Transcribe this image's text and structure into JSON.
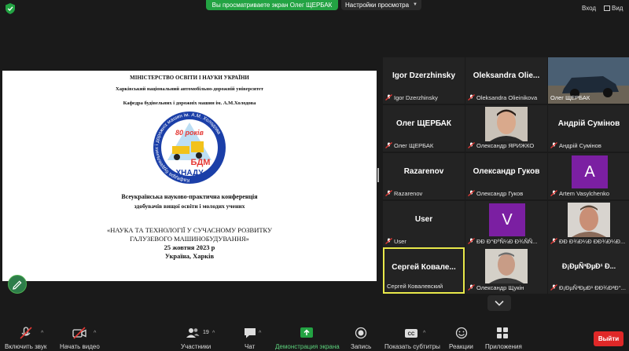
{
  "topbar": {
    "share_banner": "Вы просматриваете экран Олег ЩЕРБАК",
    "view_options": "Настройки просмотра",
    "exit_label": "Вход",
    "view_label": "Вид"
  },
  "slide": {
    "ministry": "МІНІСТЕРСТВО ОСВІТИ І НАУКИ УКРАЇНИ",
    "university": "Харківський національний автомобільно-дорожній університет",
    "department": "Кафедра будівельних і дорожніх машин   ім. А.М.Холодова",
    "logo": {
      "ring_text": "Кафедра будівельних і дорожніх машин ім. А.М. Холодова",
      "years": "80 років",
      "bdm": "БДМ",
      "hnadu": "ХНАДУ"
    },
    "conference_line1": "Всеукраїнська науково-практична конференція",
    "conference_line2": "здобувачів вищої освіти і молодих учених",
    "title_line1": "«НАУКА ТА ТЕХНОЛОГІЇ У СУЧАСНОМУ РОЗВИТКУ",
    "title_line2": "ГАЛУЗЕВОГО МАШИНОБУДУВАННЯ»",
    "date": "25 жовтня 2023 р",
    "city": "Україна, Харків"
  },
  "participants": [
    {
      "name": "Igor Dzerzhinsky",
      "caption": "Igor Dzerzhinsky"
    },
    {
      "name": "Oleksandra  Olie...",
      "caption": "Oleksandra Olieinikova"
    },
    {
      "name": "",
      "caption": "Олег ЩЕРБАК"
    },
    {
      "name": "Олег ЩЕРБАК",
      "caption": "Олег ЩЕРБАК"
    },
    {
      "name": "",
      "caption": "Олександр ЯРИЖКО"
    },
    {
      "name": "Андрій Сумінов",
      "caption": "Андрій Сумінов"
    },
    {
      "name": "Razarenov",
      "caption": "Razarenov"
    },
    {
      "name": "Олександр Гуков",
      "caption": "Олександр Гуков"
    },
    {
      "name": "A",
      "caption": "Artem Vasylchenko"
    },
    {
      "name": "User",
      "caption": "User"
    },
    {
      "name": "V",
      "caption": "ÐÐ Ð°ÐºÑ¼Ð Ð¾ÑÑ..."
    },
    {
      "name": "",
      "caption": "ÐÐ Ð¾Ð¼Ð ÐÐ¾Ð¼Ð..."
    },
    {
      "name": "Сергей  Ковале...",
      "caption": "Сергей Ковалевский"
    },
    {
      "name": "",
      "caption": "Олександр Щукін"
    },
    {
      "name": "Ð¡ÐµÑ³ÐµÐ¹  Ð...",
      "caption": "Ð¡ÐµÑ³ÐµÐ¹ ÐÐ¾Ð²Ð°..."
    }
  ],
  "toolbar": {
    "mute": "Включить звук",
    "video": "Начать видео",
    "participants": "Участники",
    "participants_count": "19",
    "chat": "Чат",
    "share": "Демонстрация экрана",
    "record": "Запись",
    "cc": "Показать субтитры",
    "reactions": "Реакции",
    "apps": "Приложения",
    "leave": "Выйти"
  },
  "colors": {
    "share_green": "#23a343",
    "leave_red": "#e02828",
    "active_speaker": "#e8e84a",
    "avatar_purple": "#7b1fa2"
  }
}
